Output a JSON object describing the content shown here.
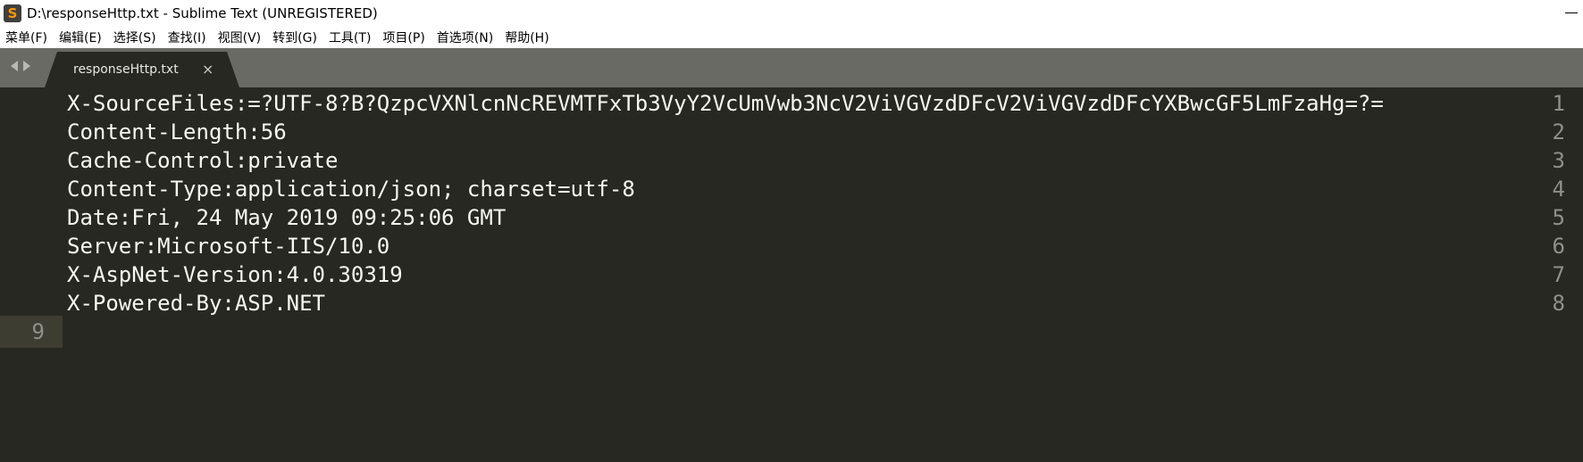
{
  "window": {
    "title": "D:\\responseHttp.txt - Sublime Text (UNREGISTERED)",
    "icon_letter": "S"
  },
  "menu": {
    "items": [
      "菜单(F)",
      "编辑(E)",
      "选择(S)",
      "查找(I)",
      "视图(V)",
      "转到(G)",
      "工具(T)",
      "项目(P)",
      "首选项(N)",
      "帮助(H)"
    ]
  },
  "tabs": [
    {
      "label": "responseHttp.txt",
      "close": "×"
    }
  ],
  "editor": {
    "lines": [
      {
        "num": "1",
        "text": "X-SourceFiles:=?UTF-8?B?QzpcVXNlcnNcREVMTFxTb3VyY2VcUmVwb3NcV2ViVGVzdDFcV2ViVGVzdDFcYXBwcGF5LmFzaHg=?="
      },
      {
        "num": "2",
        "text": "Content-Length:56"
      },
      {
        "num": "3",
        "text": "Cache-Control:private"
      },
      {
        "num": "4",
        "text": "Content-Type:application/json; charset=utf-8"
      },
      {
        "num": "5",
        "text": "Date:Fri, 24 May 2019 09:25:06 GMT"
      },
      {
        "num": "6",
        "text": "Server:Microsoft-IIS/10.0"
      },
      {
        "num": "7",
        "text": "X-AspNet-Version:4.0.30319"
      },
      {
        "num": "8",
        "text": "X-Powered-By:ASP.NET"
      },
      {
        "num": "9",
        "text": ""
      }
    ],
    "current_line": 9
  },
  "colors": {
    "background": "#272822",
    "foreground": "#f8f8f2",
    "gutter_text": "#8f908a",
    "current_line": "#3e3d32",
    "tabstrip": "#6a6a64",
    "icon_accent": "#ff9800"
  }
}
